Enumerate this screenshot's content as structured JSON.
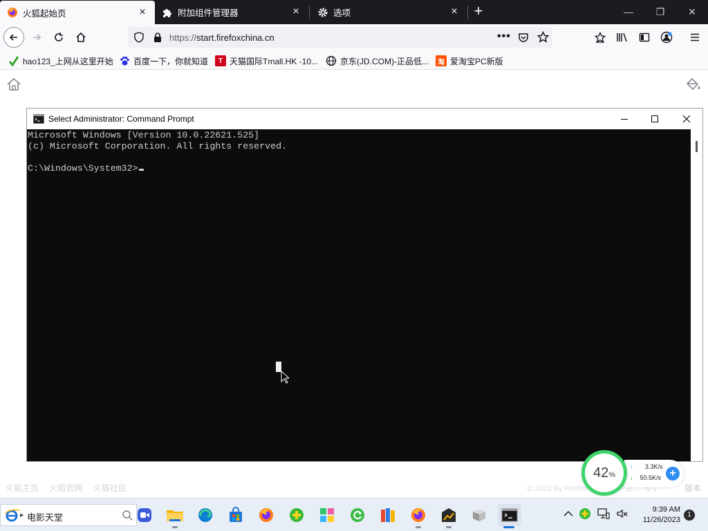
{
  "browser": {
    "tabs": [
      {
        "label": "火狐起始页",
        "icon": "firefox-icon",
        "active": true
      },
      {
        "label": "附加组件管理器",
        "icon": "puzzle-icon",
        "active": false
      },
      {
        "label": "选项",
        "icon": "gear-icon",
        "active": false
      }
    ],
    "new_tab": "+",
    "url": {
      "scheme": "https://",
      "host": "start.firefoxchina.cn"
    },
    "bookmarks": [
      {
        "label": "hao123_上网从这里开始",
        "icon": "hao123-icon"
      },
      {
        "label": "百度一下，你就知道",
        "icon": "baidu-paw-icon"
      },
      {
        "label": "天猫国际Tmall.HK -10...",
        "icon": "tmall-icon"
      },
      {
        "label": "京东(JD.COM)-正品低...",
        "icon": "globe-icon"
      },
      {
        "label": "爱淘宝PC新版",
        "icon": "taobao-icon"
      }
    ]
  },
  "page": {
    "footer_links": [
      "火狐主页",
      "火狐官网",
      "火狐社区"
    ],
    "footer_copyright": "© 2023 By Firefox ... 版 | ICP证 ... 号-1",
    "footer_version": "版本"
  },
  "cmd": {
    "title": "Select Administrator: Command Prompt",
    "lines": [
      "Microsoft Windows [Version 10.0.22621.525]",
      "(c) Microsoft Corporation. All rights reserved.",
      "",
      "C:\\Windows\\System32>"
    ]
  },
  "speed_widget": {
    "percent": "42",
    "percent_unit": "%",
    "upload": "3.3K/s",
    "download": "50.5K/s"
  },
  "taskbar": {
    "search_label": "电影天堂",
    "apps": [
      "zoom-icon",
      "file-explorer-icon",
      "edge-icon",
      "store-icon",
      "firefox-icon",
      "plus-app-icon",
      "tiles-app-icon",
      "refresh-app-icon",
      "archive-icon",
      "firefox-icon",
      "chart-app-icon",
      "vm-icon",
      "cmd-icon"
    ],
    "clock_time": "9:39 AM",
    "clock_date": "11/26/2023",
    "notification_count": "1"
  }
}
